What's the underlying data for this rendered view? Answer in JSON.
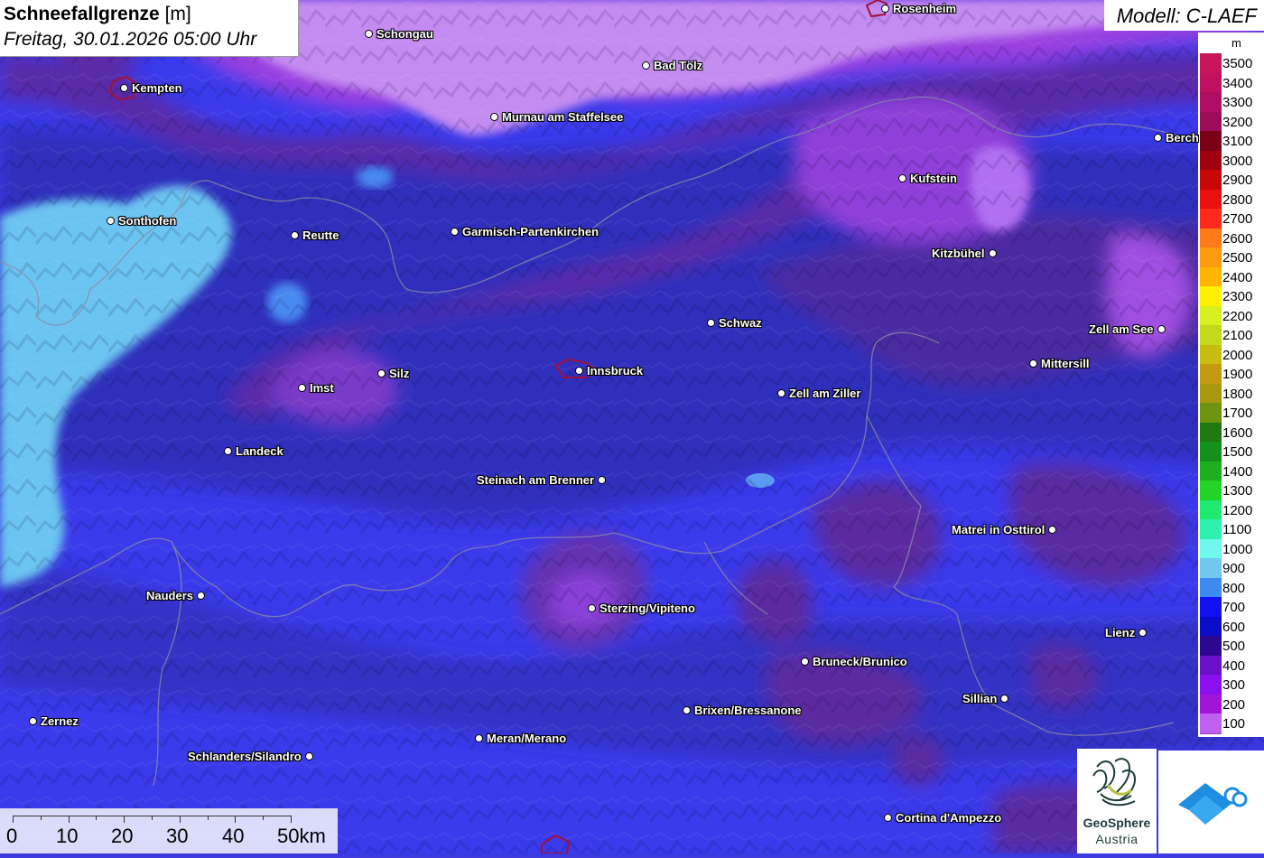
{
  "title": {
    "main": "Schneefallgrenze",
    "unit": "[m]",
    "time": "Freitag, 30.01.2026 05:00 Uhr"
  },
  "model": {
    "label": "Modell: C-LAEF"
  },
  "legend": {
    "unit": "m",
    "items": [
      {
        "value": "3500",
        "color": "#c8145a"
      },
      {
        "value": "3400",
        "color": "#c01060"
      },
      {
        "value": "3300",
        "color": "#b00e62"
      },
      {
        "value": "3200",
        "color": "#9c0c58"
      },
      {
        "value": "3100",
        "color": "#7a0018"
      },
      {
        "value": "3000",
        "color": "#a00010"
      },
      {
        "value": "2900",
        "color": "#c80808"
      },
      {
        "value": "2800",
        "color": "#e81010"
      },
      {
        "value": "2700",
        "color": "#ff2a1e"
      },
      {
        "value": "2600",
        "color": "#ff7a18"
      },
      {
        "value": "2500",
        "color": "#ff9a10"
      },
      {
        "value": "2400",
        "color": "#ffb400"
      },
      {
        "value": "2300",
        "color": "#fff000"
      },
      {
        "value": "2200",
        "color": "#d8f020"
      },
      {
        "value": "2100",
        "color": "#c4d81c"
      },
      {
        "value": "2000",
        "color": "#c8bc10"
      },
      {
        "value": "1900",
        "color": "#c49a10"
      },
      {
        "value": "1800",
        "color": "#a89810"
      },
      {
        "value": "1700",
        "color": "#6c9410"
      },
      {
        "value": "1600",
        "color": "#1e7a10"
      },
      {
        "value": "1500",
        "color": "#14901c"
      },
      {
        "value": "1400",
        "color": "#1cb020"
      },
      {
        "value": "1300",
        "color": "#22d428"
      },
      {
        "value": "1200",
        "color": "#20e870"
      },
      {
        "value": "1100",
        "color": "#30f0b0"
      },
      {
        "value": "1000",
        "color": "#70f8ec"
      },
      {
        "value": "900",
        "color": "#70c8f0"
      },
      {
        "value": "800",
        "color": "#3c8cf0"
      },
      {
        "value": "700",
        "color": "#1010f0"
      },
      {
        "value": "600",
        "color": "#0c0cc8"
      },
      {
        "value": "500",
        "color": "#2c0890"
      },
      {
        "value": "400",
        "color": "#6a10c8"
      },
      {
        "value": "300",
        "color": "#8a10f0"
      },
      {
        "value": "200",
        "color": "#a014d8"
      },
      {
        "value": "100",
        "color": "#c060f0"
      }
    ]
  },
  "cities": [
    {
      "name": "Rosenheim",
      "side": "r"
    },
    {
      "name": "Schongau",
      "side": "r"
    },
    {
      "name": "Bad Tölz",
      "side": "r"
    },
    {
      "name": "Kempten",
      "side": "r"
    },
    {
      "name": "Murnau am Staffelsee",
      "side": "r"
    },
    {
      "name": "Berchtesgaden",
      "side": "r"
    },
    {
      "name": "Kufstein",
      "side": "r"
    },
    {
      "name": "Sonthofen",
      "side": "r"
    },
    {
      "name": "Reutte",
      "side": "r"
    },
    {
      "name": "Garmisch-Partenkirchen",
      "side": "r"
    },
    {
      "name": "Kitzbühel",
      "side": "l"
    },
    {
      "name": "Schwaz",
      "side": "r"
    },
    {
      "name": "Zell am See",
      "side": "l"
    },
    {
      "name": "Silz",
      "side": "r"
    },
    {
      "name": "Innsbruck",
      "side": "r"
    },
    {
      "name": "Mittersill",
      "side": "r"
    },
    {
      "name": "Imst",
      "side": "r"
    },
    {
      "name": "Zell am Ziller",
      "side": "r"
    },
    {
      "name": "Landeck",
      "side": "r"
    },
    {
      "name": "Steinach am Brenner",
      "side": "l"
    },
    {
      "name": "Matrei in Osttirol",
      "side": "l"
    },
    {
      "name": "Nauders",
      "side": "l"
    },
    {
      "name": "Sterzing/Vipiteno",
      "side": "r"
    },
    {
      "name": "Lienz",
      "side": "l"
    },
    {
      "name": "Bruneck/Brunico",
      "side": "r"
    },
    {
      "name": "Sillian",
      "side": "l"
    },
    {
      "name": "Brixen/Bressanone",
      "side": "r"
    },
    {
      "name": "Zernez",
      "side": "r"
    },
    {
      "name": "Meran/Merano",
      "side": "r"
    },
    {
      "name": "Schlanders/Silandro",
      "side": "l"
    },
    {
      "name": "Cortina d'Ampezzo",
      "side": "r"
    }
  ],
  "scale": {
    "labels": [
      "0",
      "10",
      "20",
      "30",
      "40",
      "50km"
    ]
  },
  "logo": {
    "brand_line1": "GeoSphere",
    "brand_line2": "Austria",
    "icon": "geosphere-logo-icon",
    "app_icon": "app-cloud-logo-icon"
  },
  "colors": {
    "base": "#3636e8",
    "dark": "#2a2aa8",
    "purple": "#6a2fb0",
    "violet": "#9a3ae0",
    "lilac": "#c070f0",
    "cyan": "#70c8f0",
    "red_outline": "#a0103a"
  }
}
